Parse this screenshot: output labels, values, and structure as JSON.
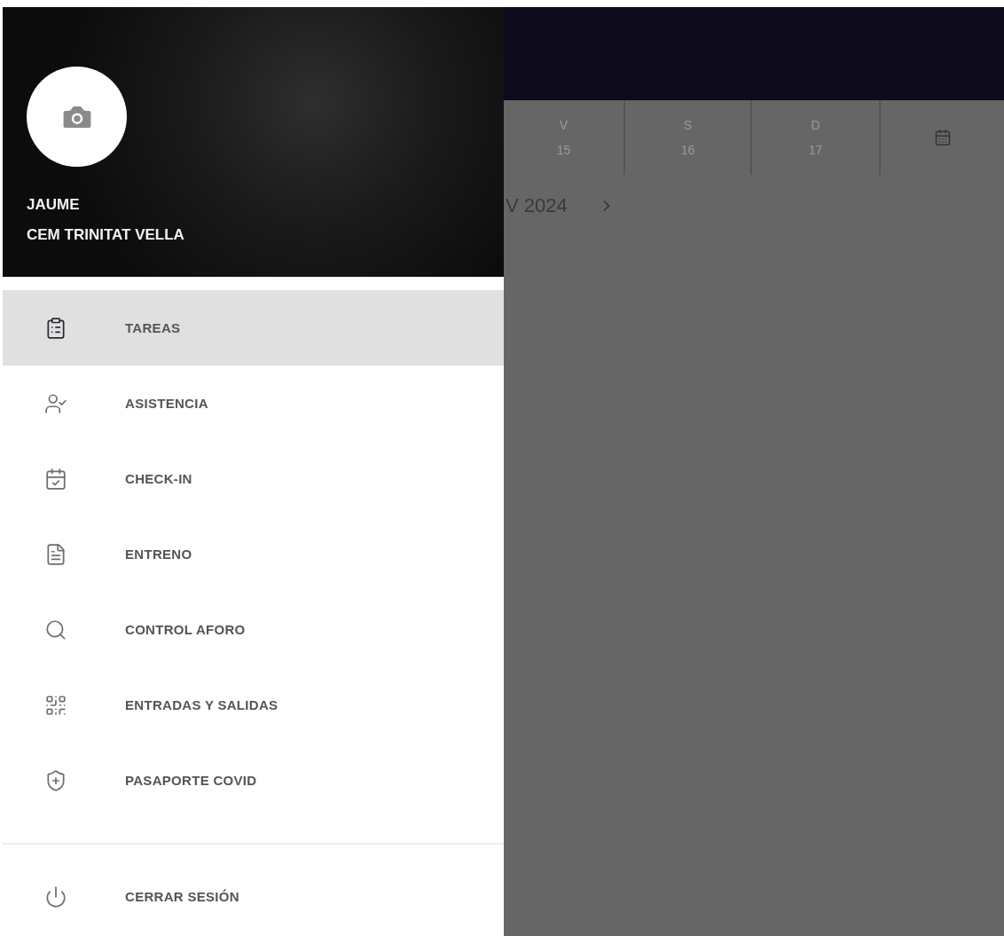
{
  "drawer": {
    "profile": {
      "name": "JAUME",
      "center": "CEM TRINITAT VELLA"
    },
    "menu": [
      {
        "label": "TAREAS",
        "selected": true
      },
      {
        "label": "ASISTENCIA",
        "selected": false
      },
      {
        "label": "CHECK-IN",
        "selected": false
      },
      {
        "label": "ENTRENO",
        "selected": false
      },
      {
        "label": "CONTROL AFORO",
        "selected": false
      },
      {
        "label": "ENTRADAS Y SALIDAS",
        "selected": false
      },
      {
        "label": "PASAPORTE COVID",
        "selected": false
      }
    ],
    "logout": {
      "label": "CERRAR SESIÓN"
    }
  },
  "background": {
    "week": [
      {
        "day": "V",
        "date": "15"
      },
      {
        "day": "S",
        "date": "16"
      },
      {
        "day": "D",
        "date": "17"
      }
    ],
    "month": "V 2024"
  }
}
